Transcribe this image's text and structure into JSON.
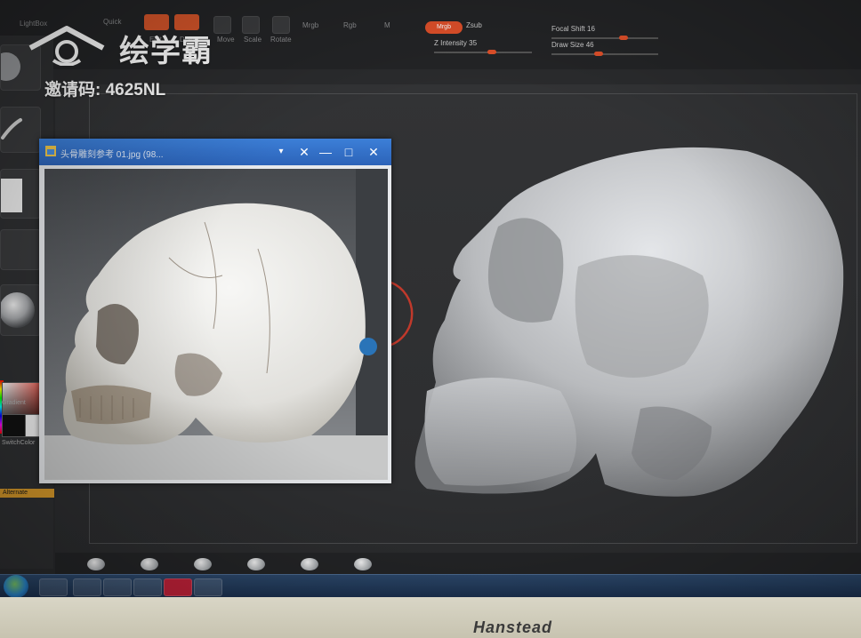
{
  "watermark": {
    "brand": "绘学霸",
    "invite_code": "邀请码: 4625NL"
  },
  "toolbar": {
    "items": [
      "LightBox",
      "Quick",
      "Edit",
      "Draw",
      "Move",
      "Scale",
      "Rotate",
      "Mrgb",
      "Rgb",
      "M"
    ],
    "mrgb": "Mrgb",
    "zsub": "Zsub",
    "focal_shift": {
      "label": "Focal Shift",
      "value": "16"
    },
    "z_intensity": {
      "label": "Z Intensity",
      "value": "35"
    },
    "draw_size": {
      "label": "Draw Size",
      "value": "46"
    }
  },
  "tray": {
    "gradient_label": "Gradient",
    "switchcolor_label": "SwitchColor",
    "alternate_label": "Alternate"
  },
  "viewer": {
    "title": "头骨雕刻参考 01.jpg (98...",
    "controls": [
      "▾",
      "✕",
      "—",
      "□",
      "✕"
    ]
  },
  "bezel": {
    "brand": "Hanstead"
  },
  "colors": {
    "accent": "#e0502a",
    "titlebar": "#3c7fd8",
    "sculpt": "#c9cbce"
  }
}
